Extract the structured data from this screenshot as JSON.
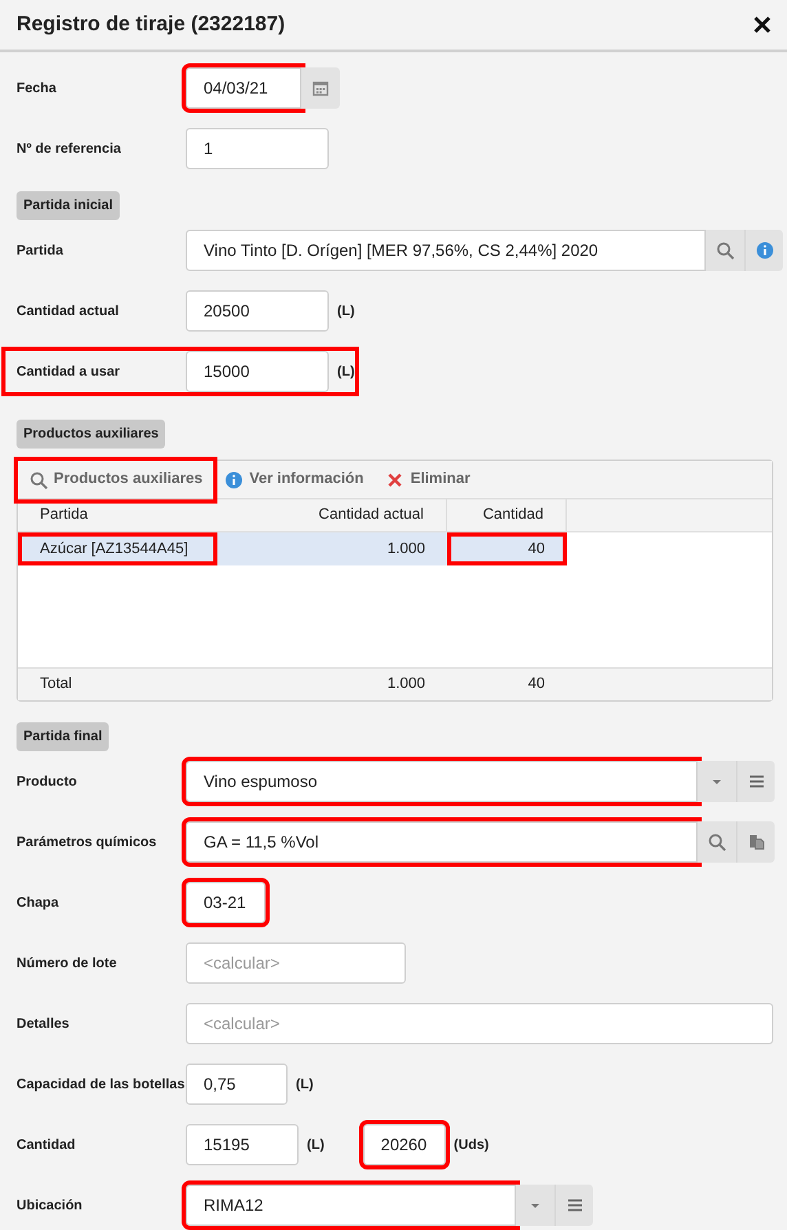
{
  "window": {
    "title": "Registro de tiraje (2322187)"
  },
  "rows": [
    {
      "kind": "field",
      "label": "Fecha",
      "inputs": [
        {
          "value": "04/03/21",
          "highlighted": true
        }
      ]
    },
    {
      "kind": "field",
      "label": "Nº de referencia",
      "inputs": [
        {
          "value": "1"
        }
      ]
    },
    {
      "kind": "section",
      "label": "Partida inicial"
    },
    {
      "kind": "field",
      "label": "Partida",
      "inputs": [
        {
          "value": "Vino Tinto [D. Orígen] [MER 97,56%, CS 2,44%] 2020"
        }
      ]
    },
    {
      "kind": "field",
      "label": "Cantidad actual",
      "inputs": [
        {
          "value": "20500",
          "unit": "(L)"
        }
      ]
    },
    {
      "kind": "field",
      "label": "Cantidad a usar",
      "highlighted": true,
      "inputs": [
        {
          "value": "15000",
          "unit": "(L)"
        }
      ]
    },
    {
      "kind": "section",
      "label": "Productos auxiliares"
    },
    {
      "kind": "grid",
      "toolbar": [
        {
          "label": "Productos auxiliares",
          "highlighted": true
        },
        {
          "label": "Ver información"
        },
        {
          "label": "Eliminar"
        }
      ],
      "columns": [
        "Partida",
        "Cantidad actual",
        "Cantidad"
      ],
      "rows": [
        {
          "selected": true,
          "cells": [
            {
              "text": "Azúcar [AZ13544A45]",
              "highlighted": true
            },
            {
              "text": "1.000"
            },
            {
              "text": "40",
              "highlighted": true
            }
          ]
        }
      ],
      "totals": [
        "Total",
        "1.000",
        "40"
      ]
    },
    {
      "kind": "section",
      "label": "Partida final"
    },
    {
      "kind": "field",
      "label": "Producto",
      "inputs": [
        {
          "value": "Vino espumoso",
          "highlighted": true
        }
      ]
    },
    {
      "kind": "field",
      "label": "Parámetros químicos",
      "inputs": [
        {
          "value": "GA = 11,5 %Vol",
          "highlighted": true
        }
      ]
    },
    {
      "kind": "field",
      "label": "Chapa",
      "inputs": [
        {
          "value": "03-21",
          "highlighted": true
        }
      ]
    },
    {
      "kind": "field",
      "label": "Número de lote",
      "inputs": [
        {
          "placeholder": "<calcular>"
        }
      ]
    },
    {
      "kind": "field",
      "label": "Detalles",
      "inputs": [
        {
          "placeholder": "<calcular>"
        }
      ]
    },
    {
      "kind": "field",
      "label": "Capacidad de las botellas",
      "inputs": [
        {
          "value": "0,75",
          "unit": "(L)"
        }
      ]
    },
    {
      "kind": "field",
      "label": "Cantidad",
      "inputs": [
        {
          "value": "15195",
          "unit": "(L)"
        },
        {
          "value": "20260",
          "unit": "(Uds)",
          "highlighted": true
        }
      ]
    },
    {
      "kind": "field",
      "label": "Ubicación",
      "inputs": [
        {
          "value": "RIMA12",
          "highlighted": true
        }
      ]
    }
  ]
}
